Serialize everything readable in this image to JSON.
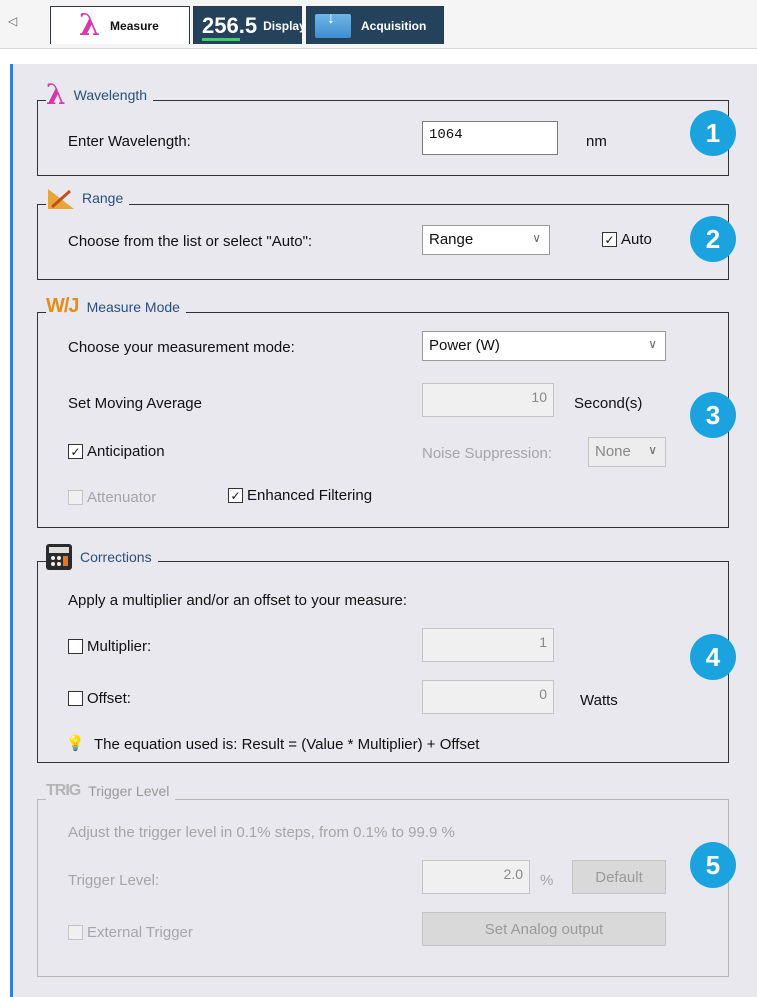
{
  "tabs": {
    "measure": {
      "label": "Measure",
      "icon": "lambda-icon"
    },
    "display": {
      "label": "Display",
      "number": "256.5",
      "icon": "display-number-icon"
    },
    "acquisition": {
      "label": "Acquisition",
      "icon": "download-folder-icon"
    }
  },
  "wavelength": {
    "title": "Wavelength",
    "label": "Enter Wavelength:",
    "value": "1064",
    "unit": "nm",
    "badge": "1"
  },
  "range": {
    "title": "Range",
    "label": "Choose from the list or select \"Auto\":",
    "select_value": "Range",
    "auto_label": "Auto",
    "auto_checked": true,
    "badge": "2"
  },
  "measure_mode": {
    "title": "Measure Mode",
    "mode_label": "Choose your measurement mode:",
    "mode_value": "Power (W)",
    "moving_avg_label": "Set Moving Average",
    "moving_avg_value": "10",
    "moving_avg_unit": "Second(s)",
    "anticipation_label": "Anticipation",
    "anticipation_checked": true,
    "noise_label": "Noise Suppression:",
    "noise_value": "None",
    "attenuator_label": "Attenuator",
    "attenuator_checked": false,
    "enhanced_label": "Enhanced Filtering",
    "enhanced_checked": true,
    "badge": "3"
  },
  "corrections": {
    "title": "Corrections",
    "intro": "Apply a multiplier and/or an offset to your measure:",
    "multiplier_label": "Multiplier:",
    "multiplier_value": "1",
    "offset_label": "Offset:",
    "offset_value": "0",
    "offset_unit": "Watts",
    "equation": "The equation used is: Result = (Value * Multiplier) + Offset",
    "badge": "4"
  },
  "trigger": {
    "title": "Trigger Level",
    "intro": "Adjust the trigger level in 0.1% steps, from 0.1% to 99.9 %",
    "level_label": "Trigger Level:",
    "level_value": "2.0",
    "level_unit": "%",
    "default_button": "Default",
    "external_label": "External Trigger",
    "analog_button": "Set Analog output",
    "badge": "5"
  },
  "colors": {
    "accent": "#1ba3df",
    "tab_dark": "#24425c",
    "legend_text": "#2a4f77"
  }
}
